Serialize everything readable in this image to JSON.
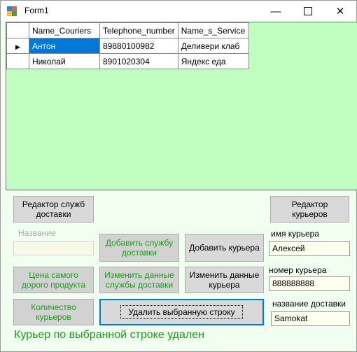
{
  "window": {
    "title": "Form1"
  },
  "grid": {
    "columns": [
      "Name_Couriers",
      "Telephone_number",
      "Name_s_Service"
    ],
    "rows": [
      [
        "Антон",
        "89880100982",
        "Деливери клаб"
      ],
      [
        "Николай",
        "8901020304",
        "Яндекс еда"
      ]
    ]
  },
  "buttons": {
    "service_editor": "Редактор служб доставки",
    "courier_editor": "Редактор курьеров",
    "add_service": "Добавить службу доставки",
    "add_courier": "Добавить курьера",
    "max_price": "Цена самого дорого продукта",
    "edit_service": "Изменить данные службы доставки",
    "edit_courier": "Изменить данные курьера",
    "couriers_count": "Количество курьеров",
    "delete_row": "Удалить выбранную строку"
  },
  "labels": {
    "name": "Название",
    "courier_name": "имя курьера",
    "courier_number": "номер курьера",
    "delivery_name": "название доставки"
  },
  "inputs": {
    "name_value": "",
    "courier_name_value": "Алексей",
    "courier_number_value": "888888888",
    "delivery_name_value": "Samokat"
  },
  "status": "Курьер по выбранной строке удален",
  "colors": {
    "grid_bg": "#c0ffc0",
    "form_bg": "#f0fff0",
    "accent": "#1f9a1f",
    "selection": "#0078d7"
  }
}
